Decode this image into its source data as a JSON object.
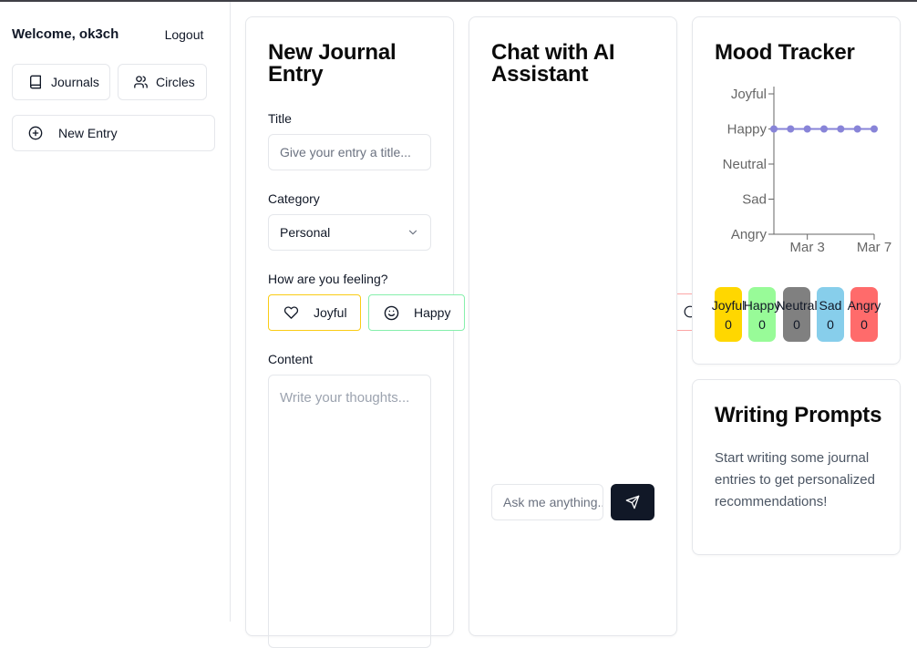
{
  "sidebar": {
    "welcome": "Welcome, ok3ch",
    "logout_label": "Logout",
    "journals_label": "Journals",
    "circles_label": "Circles",
    "new_entry_label": "New Entry"
  },
  "journal": {
    "title": "New Journal Entry",
    "title_label": "Title",
    "title_placeholder": "Give your entry a title...",
    "category_label": "Category",
    "category_value": "Personal",
    "feeling_label": "How are you feeling?",
    "moods": [
      "Joyful",
      "Happy"
    ],
    "content_label": "Content",
    "content_placeholder": "Write your thoughts..."
  },
  "chat": {
    "title": "Chat with AI Assistant",
    "input_placeholder": "Ask me anything..."
  },
  "mood_tracker": {
    "title": "Mood Tracker",
    "counts": [
      {
        "label": "Joyful",
        "value": "0",
        "color": "#ffd700"
      },
      {
        "label": "Happy",
        "value": "0",
        "color": "#98fb98"
      },
      {
        "label": "Neutral",
        "value": "0",
        "color": "#808080"
      },
      {
        "label": "Sad",
        "value": "0",
        "color": "#87ceeb"
      },
      {
        "label": "Angry",
        "value": "0",
        "color": "#ff6b6b"
      }
    ]
  },
  "prompts": {
    "title": "Writing Prompts",
    "text": "Start writing some journal entries to get personalized recommendations!"
  },
  "chart_data": {
    "type": "line",
    "x_ticks": [
      "Mar 3",
      "Mar 7"
    ],
    "y_ticks": [
      "Angry",
      "Sad",
      "Neutral",
      "Happy",
      "Joyful"
    ],
    "points_count": 7,
    "values": [
      3,
      3,
      3,
      3,
      3,
      3,
      3
    ],
    "line_color": "#8884d8"
  }
}
